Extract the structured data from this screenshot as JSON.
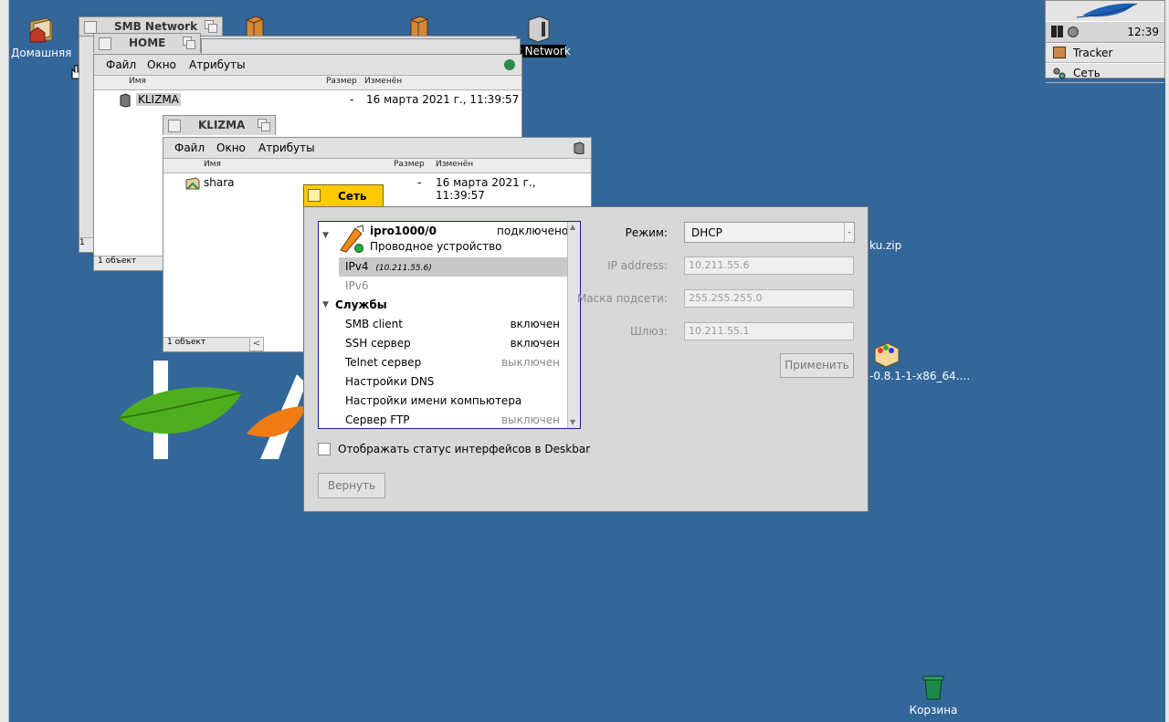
{
  "desktop": {
    "home_label": "Домашняя",
    "network_label": "IP Network",
    "zip_label": "ku.zip",
    "pkg_label": "-0.8.1-1-x86_64....",
    "trash_label": "Корзина"
  },
  "deskbar": {
    "clock": "12:39",
    "items": [
      {
        "label": "Tracker"
      },
      {
        "label": "Сеть"
      }
    ]
  },
  "windows": {
    "smb_title": "SMB Network",
    "smb_status": "1 ",
    "home_title": "HOME",
    "home_menu": [
      "Файл",
      "Окно",
      "Атрибуты"
    ],
    "home_cols": {
      "name": "Имя",
      "size": "Размер",
      "modified": "Изменён"
    },
    "home_row": {
      "name": "KLIZMA",
      "size": "-",
      "modified": "16 марта 2021 г., 11:39:57"
    },
    "home_status": "1 объект",
    "klizma_title": "KLIZMA",
    "klizma_menu": [
      "Файл",
      "Окно",
      "Атрибуты"
    ],
    "klizma_cols": {
      "name": "Имя",
      "size": "Размер",
      "modified": "Изменён"
    },
    "klizma_row": {
      "name": "shara",
      "size": "-",
      "modified": "16 марта 2021 г., 11:39:57"
    },
    "klizma_status": "1 объект"
  },
  "network": {
    "title": "Сеть",
    "interface": {
      "name": "ipro1000/0",
      "status": "подключено",
      "type": "Проводное устройство"
    },
    "ipv4_label": "IPv4",
    "ipv4_addr": "(10.211.55.6)",
    "ipv6_label": "IPv6",
    "services_header": "Службы",
    "services": [
      {
        "name": "SMB client",
        "state": "включен"
      },
      {
        "name": "SSH сервер",
        "state": "включен"
      },
      {
        "name": "Telnet сервер",
        "state": "выключен"
      },
      {
        "name": "Настройки DNS",
        "state": ""
      },
      {
        "name": "Настройки имени компьютера",
        "state": ""
      },
      {
        "name": "Сервер FTP",
        "state": "выключен"
      }
    ],
    "mode_label": "Режим:",
    "mode_value": "DHCP",
    "ip_label": "IP address:",
    "ip_value": "10.211.55.6",
    "mask_label": "Маска подсети:",
    "mask_value": "255.255.255.0",
    "gateway_label": "Шлюз:",
    "gateway_value": "10.211.55.1",
    "apply_label": "Применить",
    "deskbar_checkbox_label": "Отображать статус интерфейсов в Deskbar",
    "revert_label": "Вернуть"
  },
  "colors": {
    "desktop": "#336699",
    "active_tab": "#ffcb00",
    "selection": "#c8c8c8",
    "list_border": "#1a1aa0"
  }
}
